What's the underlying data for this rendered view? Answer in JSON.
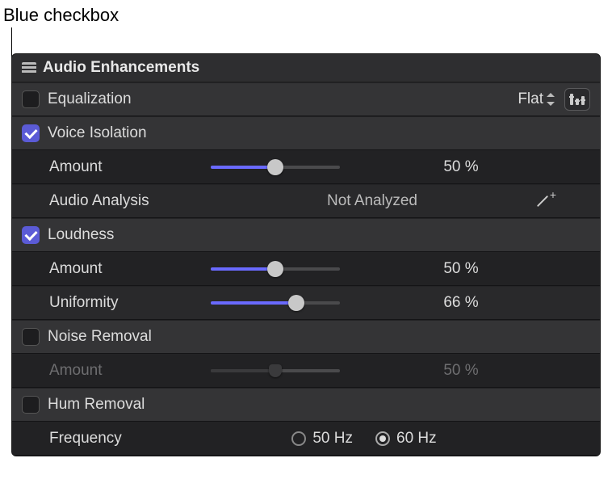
{
  "callout": "Blue checkbox",
  "panel_title": "Audio Enhancements",
  "equalization": {
    "label": "Equalization",
    "checked": false,
    "preset": "Flat"
  },
  "voice_isolation": {
    "label": "Voice Isolation",
    "checked": true,
    "amount_label": "Amount",
    "amount_value": "50 %",
    "amount_pct": 50,
    "analysis_label": "Audio Analysis",
    "analysis_status": "Not Analyzed"
  },
  "loudness": {
    "label": "Loudness",
    "checked": true,
    "amount_label": "Amount",
    "amount_value": "50 %",
    "amount_pct": 50,
    "uniformity_label": "Uniformity",
    "uniformity_value": "66 %",
    "uniformity_pct": 66
  },
  "noise_removal": {
    "label": "Noise Removal",
    "checked": false,
    "amount_label": "Amount",
    "amount_value": "50 %",
    "amount_pct": 50
  },
  "hum_removal": {
    "label": "Hum Removal",
    "checked": false,
    "frequency_label": "Frequency",
    "options": {
      "a": "50 Hz",
      "b": "60 Hz"
    },
    "selected": "b"
  }
}
